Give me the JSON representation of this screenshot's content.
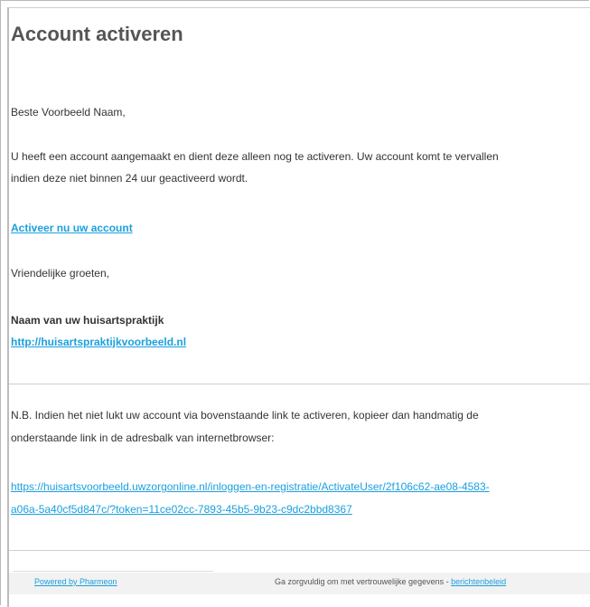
{
  "email": {
    "title": "Account activeren",
    "greeting": "Beste Voorbeeld Naam,",
    "body_line1": "U heeft een account aangemaakt en dient deze alleen nog te activeren. Uw account komt te vervallen",
    "body_line2": "indien deze niet binnen 24 uur geactiveerd wordt.",
    "activate_link": "Activeer nu uw account",
    "closing": "Vriendelijke groeten,",
    "practice_name": "Naam van uw huisartspraktijk",
    "practice_url": "http://huisartspraktijkvoorbeeld.nl",
    "note_line1": "N.B. Indien het niet lukt uw account via bovenstaande link te activeren, kopieer dan handmatig de",
    "note_line2": "onderstaande link in de adresbalk van internetbrowser:",
    "activation_url_line1": "https://huisartsvoorbeeld.uwzorgonline.nl/inloggen-en-registratie/ActivateUser/2f106c62-ae08-4583-",
    "activation_url_line2": "a06a-5a40cf5d847c/?token=11ce02cc-7893-45b5-9b23-c9dc2bbd8367"
  },
  "footer": {
    "powered_by": "Powered by Pharmeon",
    "privacy_text": "Ga zorgvuldig om met vertrouwelijke gegevens - ",
    "privacy_link": "berichtenbeleid"
  },
  "colors": {
    "link": "#1aa0de",
    "heading": "#555555",
    "text": "#333333",
    "footer_bg": "#f2f2f2"
  }
}
